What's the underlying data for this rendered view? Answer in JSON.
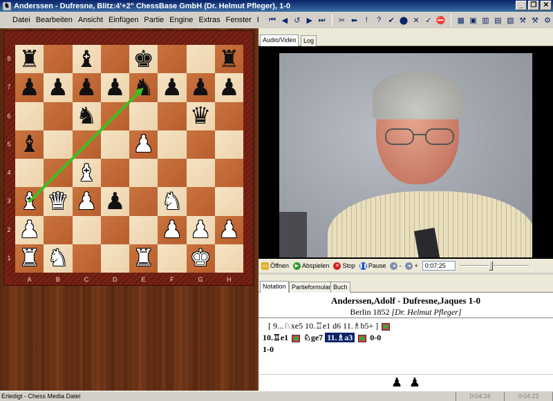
{
  "window": {
    "title": "Anderssen - Dufresne, Blitz:4'+2\" ChessBase GmbH  (Dr. Helmut Pfleger), 1-0",
    "minimize": "_",
    "maximize": "❒",
    "close": "✕"
  },
  "menu": [
    "Datei",
    "Bearbeiten",
    "Ansicht",
    "Einfügen",
    "Partie",
    "Engine",
    "Extras",
    "Fenster",
    "Hilfe"
  ],
  "toolbar": {
    "nav": [
      "⏮",
      "◀",
      "↺",
      "▶",
      "⏭"
    ],
    "tools": [
      "✂",
      "⬅",
      "!",
      "?",
      "✔",
      "⬤",
      "✕",
      "✓",
      "⛔"
    ],
    "right": [
      "▦",
      "▣",
      "▥",
      "▤",
      "▧",
      "⚒",
      "⚒",
      "⚙"
    ]
  },
  "board": {
    "ranks": [
      "8",
      "7",
      "6",
      "5",
      "4",
      "3",
      "2",
      "1"
    ],
    "files": [
      "A",
      "B",
      "C",
      "D",
      "E",
      "F",
      "G",
      "H"
    ],
    "squares": [
      [
        "br",
        "",
        "bb",
        "",
        "bk",
        "",
        "",
        "br"
      ],
      [
        "bp",
        "bp",
        "bp",
        "bp",
        "bn",
        "bp",
        "bp",
        "bp"
      ],
      [
        "",
        "",
        "bn",
        "",
        "",
        "",
        "bq",
        ""
      ],
      [
        "bb",
        "",
        "",
        "",
        "wp",
        "",
        "",
        ""
      ],
      [
        "",
        "",
        "wb",
        "",
        "",
        "",
        "",
        ""
      ],
      [
        "wb",
        "wq",
        "wp",
        "bp",
        "",
        "wn",
        "",
        ""
      ],
      [
        "wp",
        "",
        "",
        "",
        "",
        "wp",
        "wp",
        "wp"
      ],
      [
        "wr",
        "wn",
        "",
        "",
        "wr",
        "",
        "wk",
        ""
      ]
    ],
    "arrow": {
      "from": "a3",
      "to": "e7",
      "color": "#3fbf1f"
    }
  },
  "right_tabs_top": [
    "Audio/Video",
    "Log"
  ],
  "player": {
    "open": "Öffnen",
    "play": "Abspielen",
    "stop": "Stop",
    "pause": "Pause",
    "time": "0:07:25",
    "progress": 0.45
  },
  "right_tabs_bottom": [
    "Notation",
    "Partieformular",
    "Buch"
  ],
  "game": {
    "players": "Anderssen,Adolf - Dufresne,Jaques  1-0",
    "event": "Berlin 1852",
    "annotator": "[Dr. Helmut Pfleger]",
    "variation": "[ 9...♘xe5  10.♖e1   d6  11.♗b5+ ]",
    "main_a": "10.♖e1",
    "main_b": "♘ge7",
    "main_sel": "11.♗a3",
    "main_c": "0-0",
    "result": "1-0"
  },
  "material": [
    "♟",
    "♟"
  ],
  "status": {
    "text": "Erledigt - Chess Media Datei",
    "t1": "0:04:24",
    "t2": "0:04:22"
  }
}
